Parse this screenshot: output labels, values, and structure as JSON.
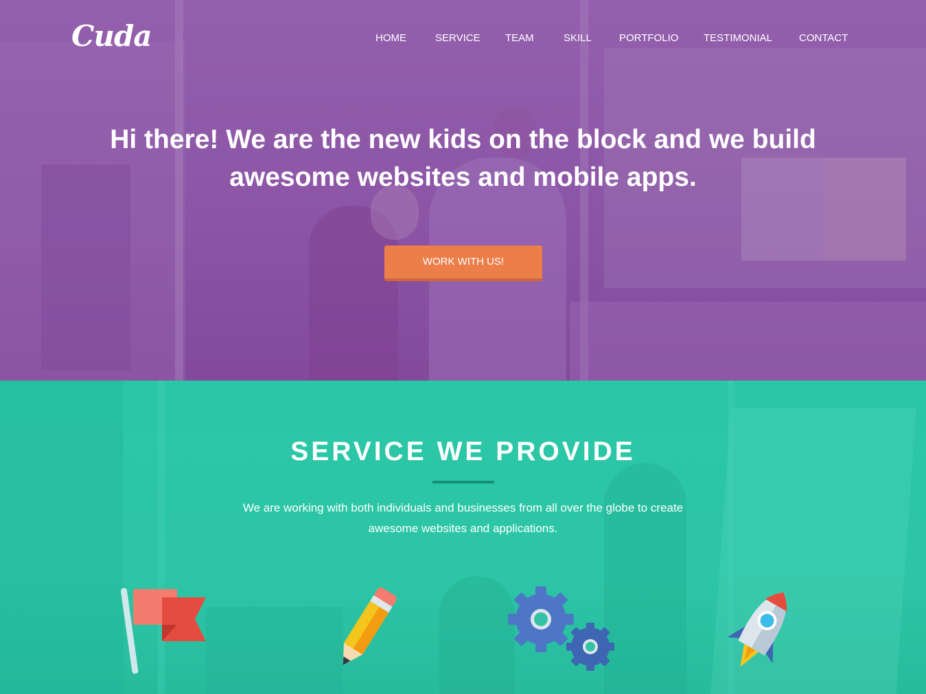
{
  "brand": {
    "logo_text": "Cuda"
  },
  "nav": {
    "items": [
      {
        "label": "HOME"
      },
      {
        "label": "SERVICE"
      },
      {
        "label": "TEAM"
      },
      {
        "label": "SKILL"
      },
      {
        "label": "PORTFOLIO"
      },
      {
        "label": "TESTIMONIAL"
      },
      {
        "label": "CONTACT"
      }
    ]
  },
  "hero": {
    "headline": "Hi there! We are the new kids on the block and we build awesome websites and mobile apps.",
    "cta_label": "WORK WITH US!"
  },
  "service": {
    "title": "SERVICE WE PROVIDE",
    "description": "We are working with both individuals and businesses from all over the globe to create awesome websites and applications.",
    "icons": [
      "flag-icon",
      "pencil-icon",
      "gears-icon",
      "rocket-icon"
    ]
  },
  "colors": {
    "hero_overlay": "#8e55a6",
    "service_overlay": "#2cc6a6",
    "cta_button": "#ec7e4a",
    "divider": "#168f77"
  }
}
